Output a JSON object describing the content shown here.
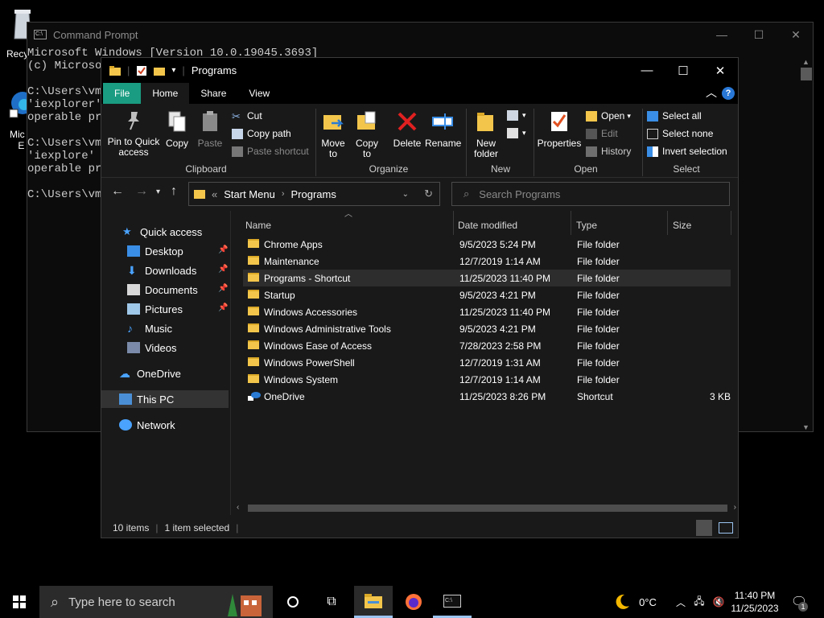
{
  "desktop": {
    "icons": [
      {
        "label": "Recy",
        "icon": "recycle-bin-icon"
      },
      {
        "label": "Mic\nE",
        "icon": "edge-icon"
      }
    ]
  },
  "cmd": {
    "title": "Command Prompt",
    "lines": [
      "Microsoft Windows [Version 10.0.19045.3693]",
      "(c) Microsoft",
      "",
      "C:\\Users\\vm",
      "'iexplorer'",
      "operable pro",
      "",
      "C:\\Users\\vm",
      "'iexplore' i",
      "operable pro",
      "",
      "C:\\Users\\vm"
    ]
  },
  "explorer": {
    "title": "Programs",
    "tabs": {
      "file": "File",
      "home": "Home",
      "share": "Share",
      "view": "View"
    },
    "ribbon": {
      "pin": "Pin to Quick\naccess",
      "copy": "Copy",
      "paste": "Paste",
      "cut": "Cut",
      "copy_path": "Copy path",
      "paste_shortcut": "Paste shortcut",
      "clipboard": "Clipboard",
      "move_to": "Move\nto",
      "copy_to": "Copy\nto",
      "delete": "Delete",
      "rename": "Rename",
      "organize": "Organize",
      "new_folder": "New\nfolder",
      "new": "New",
      "properties": "Properties",
      "open": "Open",
      "edit": "Edit",
      "history": "History",
      "open_group": "Open",
      "select_all": "Select all",
      "select_none": "Select none",
      "invert_selection": "Invert selection",
      "select": "Select"
    },
    "address": {
      "crumbs": [
        "Start Menu",
        "Programs"
      ],
      "prefix": "«"
    },
    "search_placeholder": "Search Programs",
    "nav": {
      "quick_access": "Quick access",
      "desktop": "Desktop",
      "downloads": "Downloads",
      "documents": "Documents",
      "pictures": "Pictures",
      "music": "Music",
      "videos": "Videos",
      "onedrive": "OneDrive",
      "this_pc": "This PC",
      "network": "Network"
    },
    "columns": {
      "name": "Name",
      "date": "Date modified",
      "type": "Type",
      "size": "Size"
    },
    "files": [
      {
        "name": "Chrome Apps",
        "date": "9/5/2023 5:24 PM",
        "type": "File folder",
        "size": ""
      },
      {
        "name": "Maintenance",
        "date": "12/7/2019 1:14 AM",
        "type": "File folder",
        "size": ""
      },
      {
        "name": "Programs - Shortcut",
        "date": "11/25/2023 11:40 PM",
        "type": "File folder",
        "size": ""
      },
      {
        "name": "Startup",
        "date": "9/5/2023 4:21 PM",
        "type": "File folder",
        "size": ""
      },
      {
        "name": "Windows Accessories",
        "date": "11/25/2023 11:40 PM",
        "type": "File folder",
        "size": ""
      },
      {
        "name": "Windows Administrative Tools",
        "date": "9/5/2023 4:21 PM",
        "type": "File folder",
        "size": ""
      },
      {
        "name": "Windows Ease of Access",
        "date": "7/28/2023 2:58 PM",
        "type": "File folder",
        "size": ""
      },
      {
        "name": "Windows PowerShell",
        "date": "12/7/2019 1:31 AM",
        "type": "File folder",
        "size": ""
      },
      {
        "name": "Windows System",
        "date": "12/7/2019 1:14 AM",
        "type": "File folder",
        "size": ""
      },
      {
        "name": "OneDrive",
        "date": "11/25/2023 8:26 PM",
        "type": "Shortcut",
        "size": "3 KB"
      }
    ],
    "status": {
      "count": "10 items",
      "selected": "1 item selected"
    }
  },
  "taskbar": {
    "search_placeholder": "Type here to search",
    "temperature": "0°C",
    "time": "11:40 PM",
    "date": "11/25/2023",
    "notification_count": "1"
  },
  "colors": {
    "accent": "#1a9c82",
    "folder": "#f3c64b",
    "selection": "#2d2d2d"
  }
}
